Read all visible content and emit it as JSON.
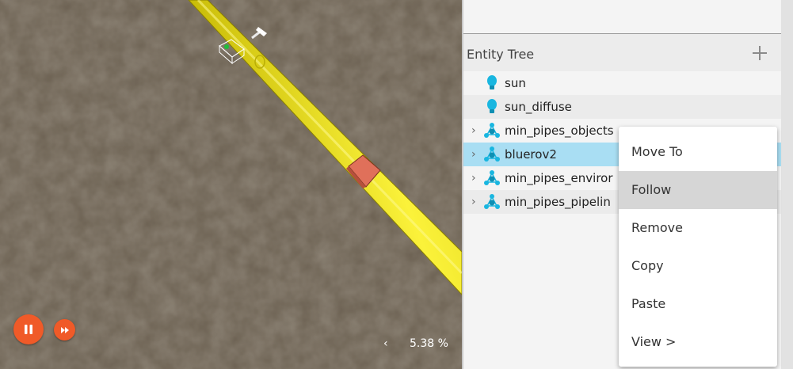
{
  "scene": {
    "rtf_chevron": "‹",
    "rtf_value": "5.38 %",
    "colors": {
      "ground": "#6b6051",
      "pipe": "#f2e51b",
      "control": "#f05a28"
    }
  },
  "entity_tree": {
    "title": "Entity Tree",
    "add_icon": "plus-icon",
    "items": [
      {
        "label": "sun",
        "icon": "light-bulb-icon",
        "expandable": false,
        "selected": false
      },
      {
        "label": "sun_diffuse",
        "icon": "light-bulb-icon",
        "expandable": false,
        "selected": false
      },
      {
        "label": "min_pipes_objects",
        "icon": "model-icon",
        "expandable": true,
        "selected": false
      },
      {
        "label": "bluerov2",
        "icon": "model-icon",
        "expandable": true,
        "selected": true
      },
      {
        "label": "min_pipes_enviror",
        "icon": "model-icon",
        "expandable": true,
        "selected": false
      },
      {
        "label": "min_pipes_pipelin",
        "icon": "model-icon",
        "expandable": true,
        "selected": false
      }
    ]
  },
  "context_menu": {
    "items": [
      {
        "label": "Move To",
        "highlighted": false
      },
      {
        "label": "Follow",
        "highlighted": true
      },
      {
        "label": "Remove",
        "highlighted": false
      },
      {
        "label": "Copy",
        "highlighted": false
      },
      {
        "label": "Paste",
        "highlighted": false
      },
      {
        "label": "View >",
        "highlighted": false
      }
    ]
  }
}
